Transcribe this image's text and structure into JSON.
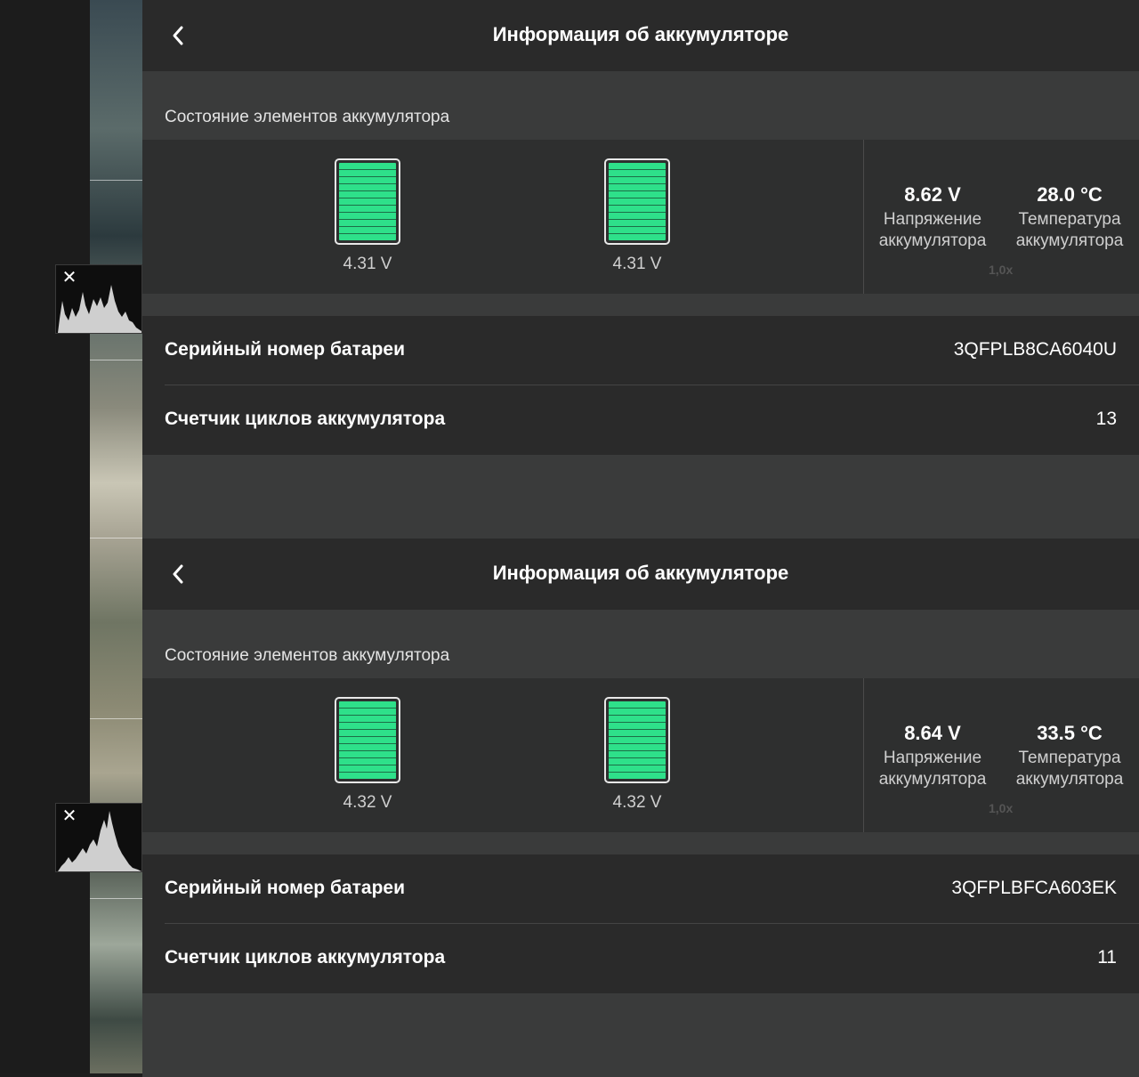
{
  "panels": [
    {
      "title": "Информация об аккумуляторе",
      "section_label": "Состояние элементов аккумулятора",
      "cells": [
        {
          "voltage": "4.31 V",
          "charge_percent": 100
        },
        {
          "voltage": "4.31 V",
          "charge_percent": 100
        }
      ],
      "voltage_value": "8.62 V",
      "voltage_label_1": "Напряжение",
      "voltage_label_2": "аккумулятора",
      "temp_value": "28.0 °C",
      "temp_label_1": "Температура",
      "temp_label_2": "аккумулятора",
      "ghost_text": "1,0x",
      "serial_label": "Серийный номер батареи",
      "serial_value": "3QFPLB8CA6040U",
      "cycles_label": "Счетчик циклов аккумулятора",
      "cycles_value": "13"
    },
    {
      "title": "Информация об аккумуляторе",
      "section_label": "Состояние элементов аккумулятора",
      "cells": [
        {
          "voltage": "4.32 V",
          "charge_percent": 100
        },
        {
          "voltage": "4.32 V",
          "charge_percent": 100
        }
      ],
      "voltage_value": "8.64 V",
      "voltage_label_1": "Напряжение",
      "voltage_label_2": "аккумулятора",
      "temp_value": "33.5 °C",
      "temp_label_1": "Температура",
      "temp_label_2": "аккумулятора",
      "ghost_text": "1,0x",
      "serial_label": "Серийный номер батареи",
      "serial_value": "3QFPLBFCA603EK",
      "cycles_label": "Счетчик циклов аккумулятора",
      "cycles_value": "11"
    }
  ],
  "histograms": [
    {
      "close_icon": "close-icon"
    },
    {
      "close_icon": "close-icon"
    }
  ],
  "colors": {
    "cell_fill": "#2ee08a",
    "header_bg": "#2a2a2a",
    "panel_bg": "#3a3b3b"
  }
}
